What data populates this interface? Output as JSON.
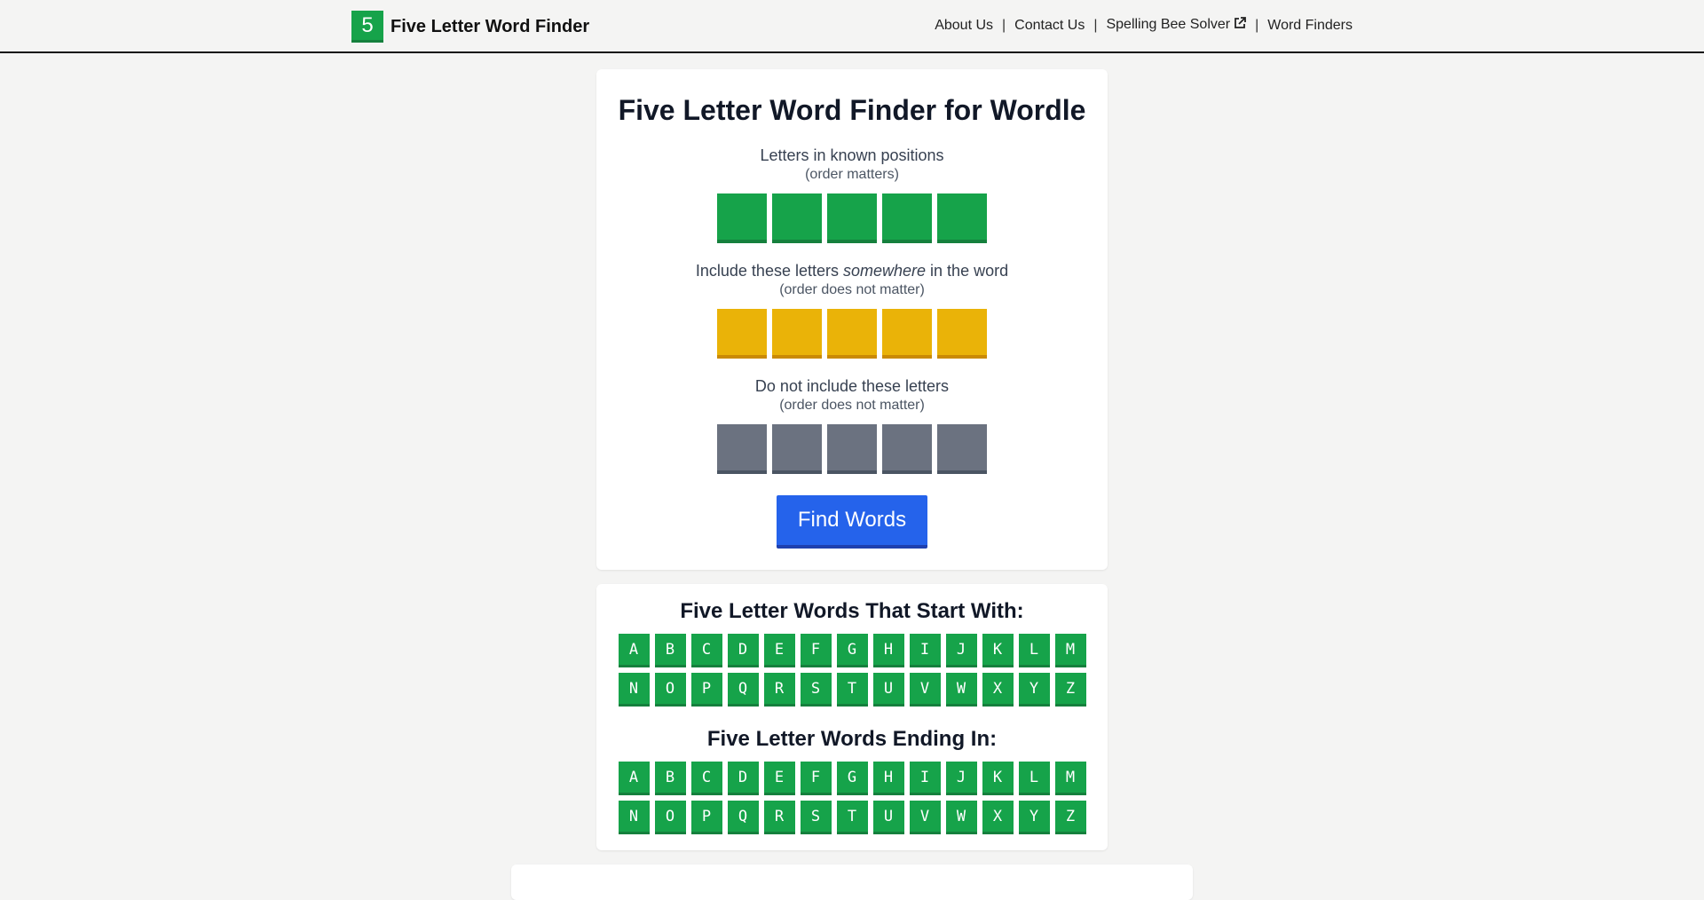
{
  "header": {
    "logo_char": "5",
    "title": "Five Letter Word Finder",
    "nav": [
      {
        "label": "About Us"
      },
      {
        "label": "Contact Us"
      },
      {
        "label": "Spelling Bee Solver",
        "icon": "external-link-icon"
      },
      {
        "label": "Word Finders"
      }
    ],
    "separator": "|"
  },
  "main": {
    "title": "Five Letter Word Finder for Wordle",
    "known": {
      "label": "Letters in known positions",
      "sub": "(order matters)"
    },
    "include": {
      "label_pre": "Include these letters ",
      "label_em": "somewhere",
      "label_post": " in the word",
      "sub": "(order does not matter)"
    },
    "exclude": {
      "label": "Do not include these letters",
      "sub": "(order does not matter)"
    },
    "find_button": "Find Words"
  },
  "links": {
    "start_title": "Five Letter Words That Start With:",
    "end_title": "Five Letter Words Ending In:",
    "letters": [
      "A",
      "B",
      "C",
      "D",
      "E",
      "F",
      "G",
      "H",
      "I",
      "J",
      "K",
      "L",
      "M",
      "N",
      "O",
      "P",
      "Q",
      "R",
      "S",
      "T",
      "U",
      "V",
      "W",
      "X",
      "Y",
      "Z"
    ]
  },
  "colors": {
    "green": "#16a34a",
    "yellow": "#eab308",
    "gray": "#6b7280",
    "blue": "#2563eb"
  }
}
